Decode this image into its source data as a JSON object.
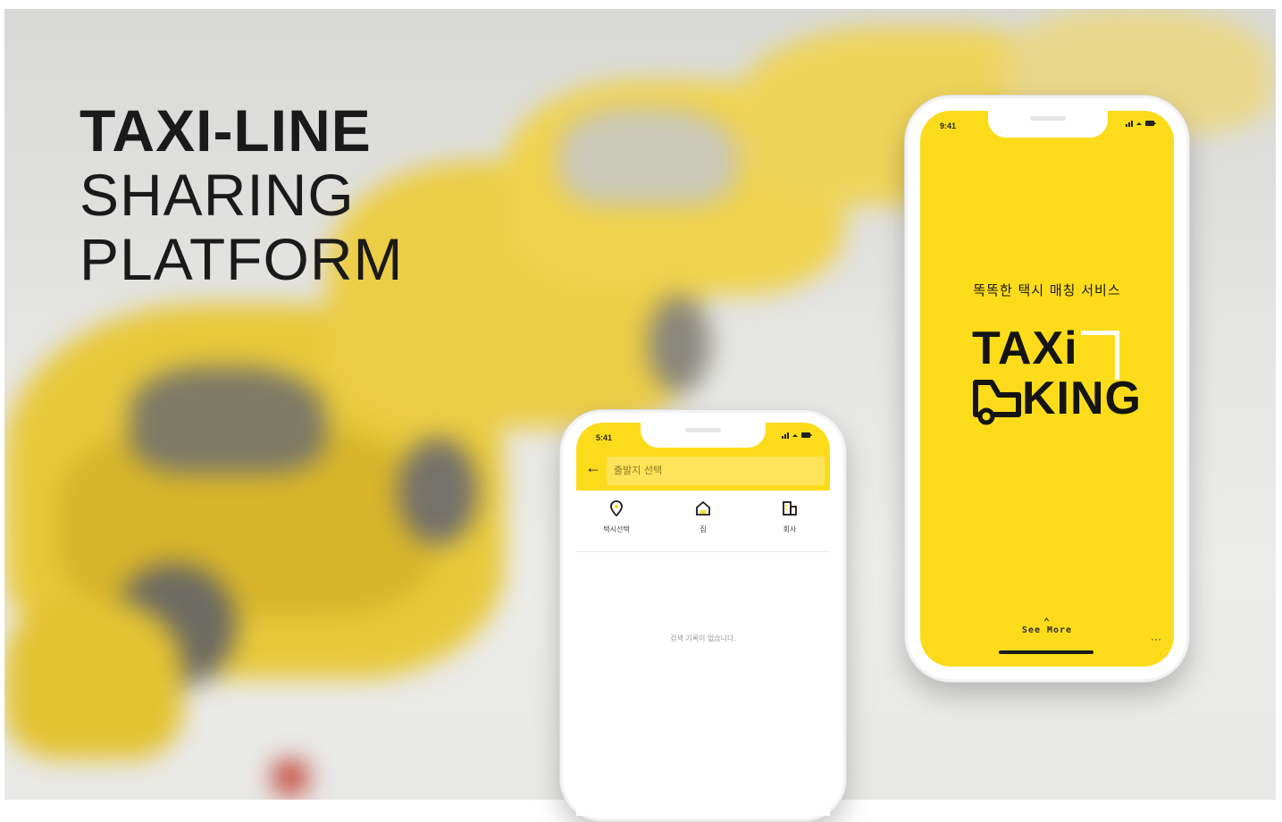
{
  "hero": {
    "line1": "TAXI-LINE",
    "line2": "SHARING",
    "line3": "PLATFORM"
  },
  "colors": {
    "brand_yellow": "#fcdc1a",
    "text_dark": "#1a1a1a",
    "white": "#ffffff"
  },
  "phone_left": {
    "status_time": "5:41",
    "status_icons": "signal-wifi-battery",
    "back_icon": "back-arrow-icon",
    "search_value": "출발지 선택",
    "shortcuts": [
      {
        "icon": "location-pin-icon",
        "label": "택시선택"
      },
      {
        "icon": "home-icon",
        "label": "집"
      },
      {
        "icon": "building-icon",
        "label": "회사"
      }
    ],
    "empty_message": "검색 기록이 없습니다."
  },
  "phone_right": {
    "status_time": "9:41",
    "status_icons": "signal-wifi-battery",
    "tagline": "똑똑한 택시 매칭 서비스",
    "logo_line1": "TAXi",
    "logo_line2": "KING",
    "see_more": "See More",
    "more_dots": "···"
  }
}
